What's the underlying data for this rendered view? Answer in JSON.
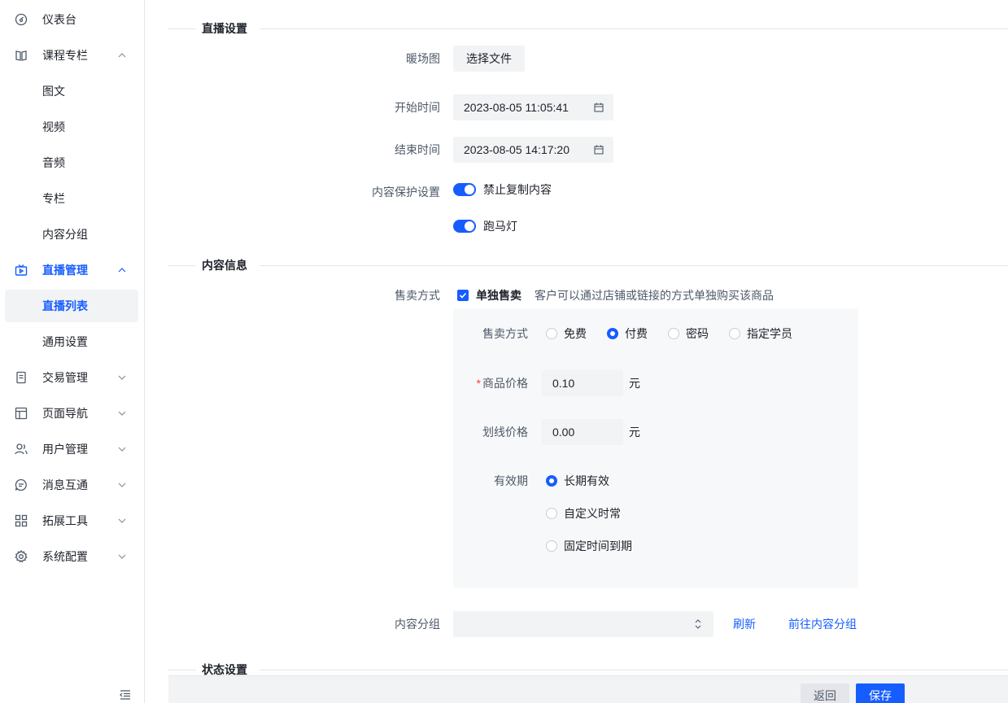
{
  "sidebar": {
    "items": [
      {
        "label": "仪表台",
        "icon": "dashboard-icon"
      },
      {
        "label": "课程专栏",
        "icon": "book-icon"
      },
      {
        "label": "图文"
      },
      {
        "label": "视频"
      },
      {
        "label": "音频"
      },
      {
        "label": "专栏"
      },
      {
        "label": "内容分组"
      },
      {
        "label": "直播管理",
        "icon": "tv-icon"
      },
      {
        "label": "直播列表"
      },
      {
        "label": "通用设置"
      },
      {
        "label": "交易管理",
        "icon": "receipt-icon"
      },
      {
        "label": "页面导航",
        "icon": "layout-icon"
      },
      {
        "label": "用户管理",
        "icon": "users-icon"
      },
      {
        "label": "消息互通",
        "icon": "message-icon"
      },
      {
        "label": "拓展工具",
        "icon": "apps-icon"
      },
      {
        "label": "系统配置",
        "icon": "gear-icon"
      }
    ]
  },
  "live_settings": {
    "title": "直播设置",
    "warmup_label": "暖场图",
    "choose_file": "选择文件",
    "start_label": "开始时间",
    "start_value": "2023-08-05 11:05:41",
    "end_label": "结束时间",
    "end_value": "2023-08-05 14:17:20",
    "protect_label": "内容保护设置",
    "no_copy": "禁止复制内容",
    "marquee": "跑马灯"
  },
  "content_info": {
    "title": "内容信息",
    "sale_label": "售卖方式",
    "single_sale": "单独售卖",
    "single_sale_desc": "客户可以通过店铺或链接的方式单独购买该商品",
    "panel": {
      "sale_mode_label": "售卖方式",
      "sale_modes": [
        "免费",
        "付费",
        "密码",
        "指定学员"
      ],
      "sale_mode_selected": "付费",
      "required_mark": "*",
      "price_label": "商品价格",
      "price_value": "0.10",
      "price_unit": "元",
      "strike_label": "划线价格",
      "strike_value": "0.00",
      "strike_unit": "元",
      "validity_label": "有效期",
      "validity_options": [
        "长期有效",
        "自定义时常",
        "固定时间到期"
      ],
      "validity_selected": "长期有效"
    },
    "group_label": "内容分组",
    "group_value": "",
    "refresh": "刷新",
    "goto_group": "前往内容分组"
  },
  "status": {
    "title": "状态设置"
  },
  "footer": {
    "back": "返回",
    "save": "保存"
  },
  "colors": {
    "primary": "#165dff",
    "danger": "#f53f3f",
    "text": "#1d2129"
  }
}
